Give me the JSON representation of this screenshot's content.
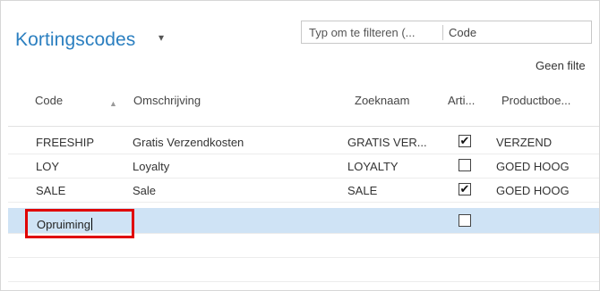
{
  "page": {
    "title": "Kortingscodes",
    "title_caret": "▾"
  },
  "filter": {
    "placeholder": "Typ om te filteren (...",
    "field": "Code",
    "no_filter": "Geen filte"
  },
  "columns": [
    {
      "label": "Code"
    },
    {
      "label": "Omschrijving"
    },
    {
      "label": "Zoeknaam"
    },
    {
      "label": "Arti..."
    },
    {
      "label": "Productboe..."
    }
  ],
  "sort_indicator": "▲",
  "rows": [
    {
      "code": "FREESHIP",
      "description": "Gratis Verzendkosten",
      "search_name": "GRATIS VER...",
      "checked": true,
      "product": "VERZEND"
    },
    {
      "code": "LOY",
      "description": "Loyalty",
      "search_name": "LOYALTY",
      "checked": false,
      "product": "GOED HOOG"
    },
    {
      "code": "SALE",
      "description": "Sale",
      "search_name": "SALE",
      "checked": true,
      "product": "GOED HOOG"
    },
    {
      "code": "",
      "description": "",
      "search_name": "",
      "checked": false,
      "product": ""
    }
  ],
  "edit_row": {
    "value": "Opruiming",
    "highlight_color": "#e00000",
    "selected_color": "#cfe3f5"
  },
  "check_glyph": "✔"
}
